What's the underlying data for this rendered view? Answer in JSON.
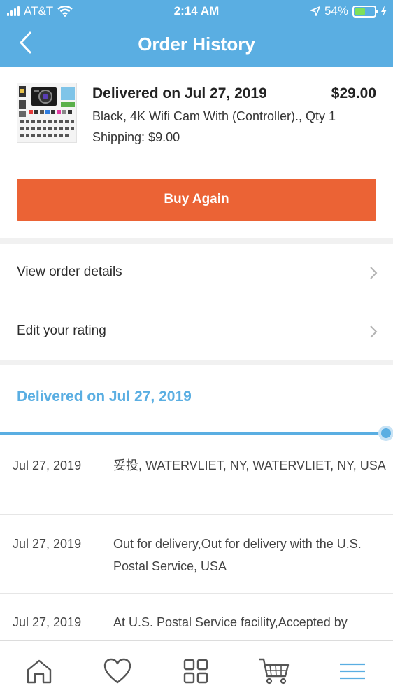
{
  "status_bar": {
    "carrier": "AT&T",
    "time": "2:14 AM",
    "battery": "54%",
    "battery_level": 0.54
  },
  "header": {
    "title": "Order History",
    "back_icon": "chevron-left-icon"
  },
  "order": {
    "status": "Delivered on Jul 27, 2019",
    "price": "$29.00",
    "description": "Black, 4K Wifi Cam With (Controller)., Qty 1",
    "shipping": "Shipping: $9.00",
    "buy_again_label": "Buy Again"
  },
  "menu": [
    {
      "label": "View order details",
      "icon": "chevron-right-icon"
    },
    {
      "label": "Edit your rating",
      "icon": "chevron-right-icon"
    }
  ],
  "tracking": {
    "title": "Delivered on Jul 27, 2019",
    "events": [
      {
        "date": "Jul 27, 2019",
        "description": "妥投, WATERVLIET, NY, WATERVLIET, NY, USA"
      },
      {
        "date": "Jul 27, 2019",
        "description": "Out for delivery,Out for delivery with the U.S. Postal Service, USA"
      },
      {
        "date": "Jul 27, 2019",
        "description": "At U.S. Postal Service facility,Accepted by"
      }
    ]
  },
  "tabbar": {
    "items": [
      "home-icon",
      "heart-icon",
      "grid-icon",
      "cart-icon",
      "menu-icon"
    ]
  },
  "colors": {
    "header": "#5aaee2",
    "accent": "#eb6335",
    "battery": "#7fe05a"
  }
}
